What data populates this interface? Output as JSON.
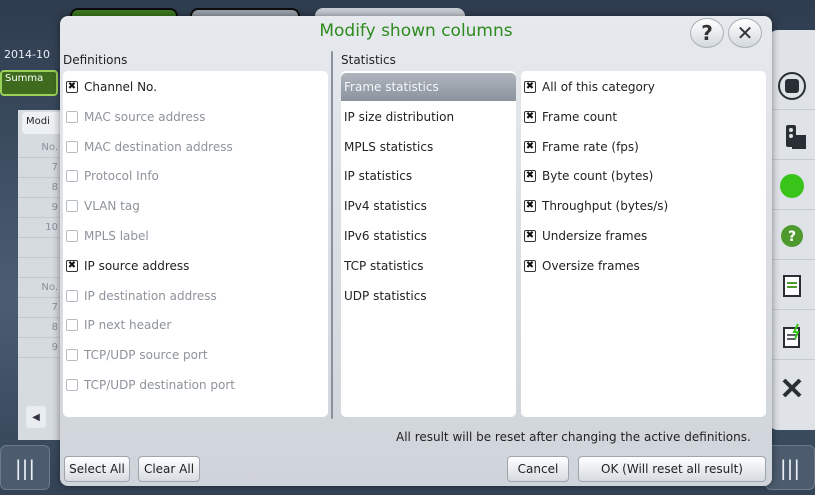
{
  "background": {
    "date": "2014-10",
    "summary": "Summa",
    "mod_button": "Modi",
    "table_rows": [
      "No.",
      "7",
      "8",
      "9",
      "10",
      "",
      "",
      "No.",
      "7",
      "8",
      "9"
    ],
    "right_bar_icons": [
      "stop-icon",
      "traffic-light-icon",
      "status-green-icon",
      "help-icon",
      "report-icon",
      "edit-report-icon",
      "close-icon"
    ],
    "corner_left_icon": "|||",
    "corner_right_icon": "|||"
  },
  "dialog": {
    "title": "Modify shown columns",
    "help_label": "?",
    "close_label": "✕",
    "definitions_header": "Definitions",
    "statistics_header": "Statistics",
    "definitions": [
      {
        "label": "Channel No.",
        "checked": true
      },
      {
        "label": "MAC source address",
        "checked": false
      },
      {
        "label": "MAC destination address",
        "checked": false
      },
      {
        "label": "Protocol Info",
        "checked": false
      },
      {
        "label": "VLAN tag",
        "checked": false
      },
      {
        "label": "MPLS label",
        "checked": false
      },
      {
        "label": "IP source address",
        "checked": true
      },
      {
        "label": "IP destination address",
        "checked": false
      },
      {
        "label": "IP next header",
        "checked": false
      },
      {
        "label": "TCP/UDP source port",
        "checked": false
      },
      {
        "label": "TCP/UDP destination port",
        "checked": false
      }
    ],
    "categories": [
      {
        "label": "Frame statistics",
        "selected": true
      },
      {
        "label": "IP size distribution",
        "selected": false
      },
      {
        "label": "MPLS statistics",
        "selected": false
      },
      {
        "label": "IP statistics",
        "selected": false
      },
      {
        "label": "IPv4 statistics",
        "selected": false
      },
      {
        "label": "IPv6 statistics",
        "selected": false
      },
      {
        "label": "TCP statistics",
        "selected": false
      },
      {
        "label": "UDP statistics",
        "selected": false
      }
    ],
    "statistics": [
      {
        "label": "All of this category",
        "checked": true
      },
      {
        "label": "Frame count",
        "checked": true
      },
      {
        "label": "Frame rate (fps)",
        "checked": true
      },
      {
        "label": "Byte count (bytes)",
        "checked": true
      },
      {
        "label": "Throughput (bytes/s)",
        "checked": true
      },
      {
        "label": "Undersize frames",
        "checked": true
      },
      {
        "label": "Oversize frames",
        "checked": true
      }
    ],
    "notice": "All result will be reset after changing the active definitions.",
    "buttons": {
      "select_all": "Select All",
      "clear_all": "Clear All",
      "cancel": "Cancel",
      "ok": "OK (Will reset all result)"
    }
  },
  "colors": {
    "title_green": "#2e8b1f",
    "status_green": "#39c41a",
    "help_green": "#4f9a2e"
  }
}
